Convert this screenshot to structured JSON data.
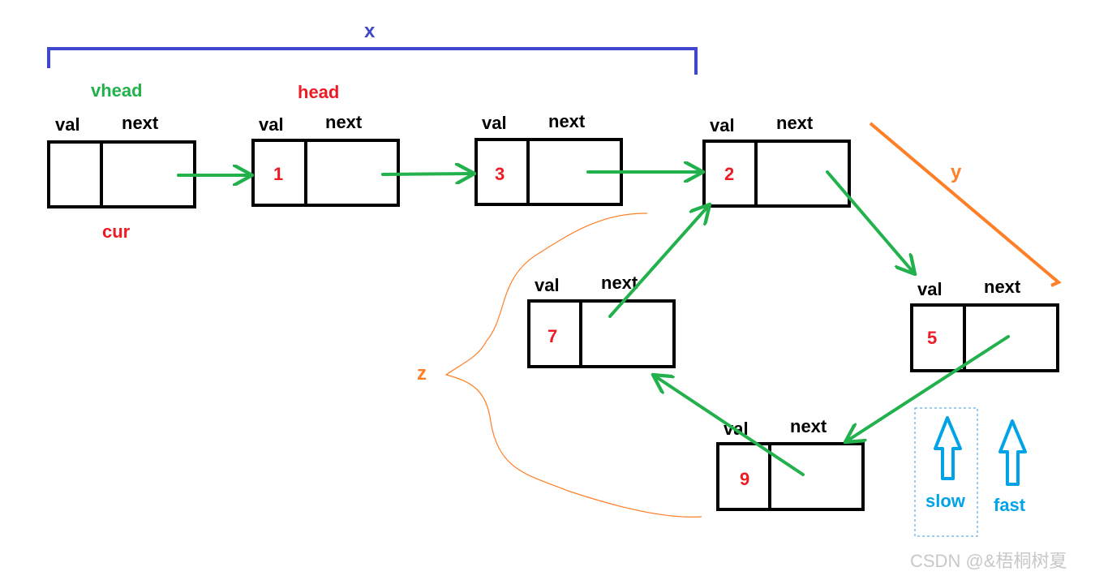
{
  "colors": {
    "arrow": "#22b14c",
    "bracket": "#3f48cc",
    "orange": "#ff7f27",
    "red": "#ed1c24",
    "pointer": "#00a2e8",
    "green_label": "#22b14c"
  },
  "field_labels": {
    "val": "val",
    "next": "next"
  },
  "nodes": [
    {
      "id": "vhead",
      "value": ""
    },
    {
      "id": "head",
      "value": "1"
    },
    {
      "id": "n3",
      "value": "3"
    },
    {
      "id": "n2",
      "value": "2"
    },
    {
      "id": "n5",
      "value": "5"
    },
    {
      "id": "n7",
      "value": "7"
    },
    {
      "id": "n9",
      "value": "9"
    }
  ],
  "labels": {
    "vhead": "vhead",
    "head": "head",
    "cur": "cur",
    "x": "x",
    "y": "y",
    "z": "z",
    "slow": "slow",
    "fast": "fast"
  },
  "watermark": "CSDN @&梧桐树夏"
}
